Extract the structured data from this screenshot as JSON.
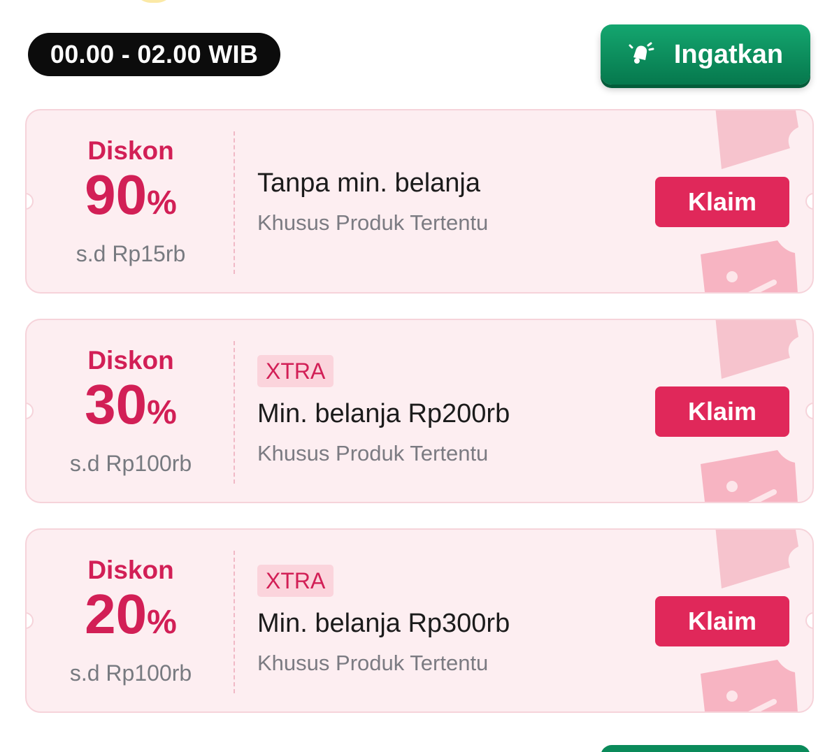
{
  "header": {
    "time_range": "00.00 - 02.00 WIB",
    "remind_label": "Ingatkan"
  },
  "vouchers": [
    {
      "label": "Diskon",
      "percent": "90",
      "percent_sign": "%",
      "cap": "s.d Rp15rb",
      "badge": "",
      "condition": "Tanpa min. belanja",
      "scope": "Khusus Produk Tertentu",
      "claim_label": "Klaim"
    },
    {
      "label": "Diskon",
      "percent": "30",
      "percent_sign": "%",
      "cap": "s.d Rp100rb",
      "badge": "XTRA",
      "condition": "Min. belanja Rp200rb",
      "scope": "Khusus Produk Tertentu",
      "claim_label": "Klaim"
    },
    {
      "label": "Diskon",
      "percent": "20",
      "percent_sign": "%",
      "cap": "s.d Rp100rb",
      "badge": "XTRA",
      "condition": "Min. belanja Rp300rb",
      "scope": "Khusus Produk Tertentu",
      "claim_label": "Klaim"
    }
  ],
  "colors": {
    "accent": "#e0285a",
    "accent_text": "#d21f56",
    "voucher_bg": "#fdeef1",
    "remind_bg": "#0a8a5a",
    "time_pill_bg": "#0c0c0c"
  },
  "icons": {
    "remind": "bell-ring-icon",
    "voucher_decoration": "coupon-ticket-icon"
  }
}
